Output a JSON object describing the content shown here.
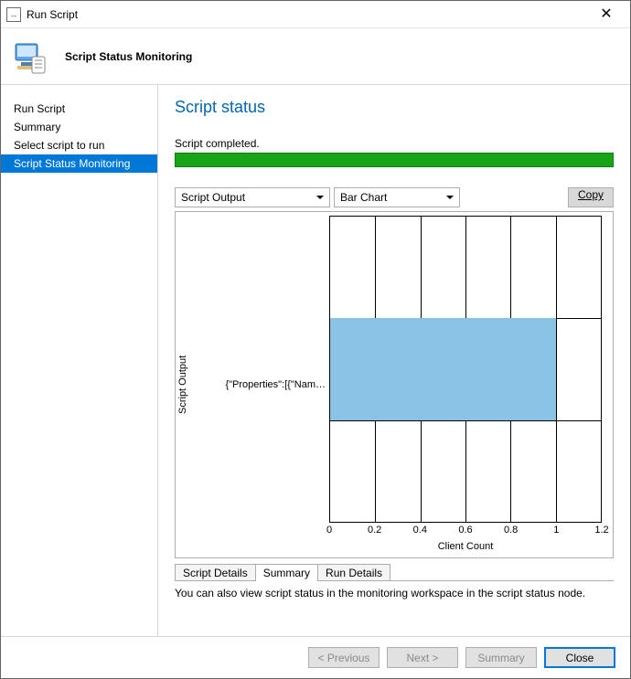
{
  "window": {
    "title": "Run Script"
  },
  "header": {
    "title": "Script Status Monitoring"
  },
  "sidebar": {
    "items": [
      {
        "label": "Run Script",
        "selected": false
      },
      {
        "label": "Summary",
        "selected": false
      },
      {
        "label": "Select script to run",
        "selected": false
      },
      {
        "label": "Script Status Monitoring",
        "selected": true
      }
    ]
  },
  "main": {
    "page_title": "Script status",
    "status_text": "Script completed.",
    "progress_color": "#17a417",
    "combo_output": "Script Output",
    "combo_charttype": "Bar Chart",
    "copy_label": "Copy",
    "hint": "You can also view script status in the monitoring workspace in the script status node.",
    "tabs": [
      {
        "label": "Script Details",
        "active": false
      },
      {
        "label": "Summary",
        "active": true
      },
      {
        "label": "Run Details",
        "active": false
      }
    ]
  },
  "chart_data": {
    "type": "bar",
    "orientation": "horizontal",
    "categories": [
      "{\"Properties\":[{\"Nam…"
    ],
    "values": [
      1
    ],
    "ylabel": "Script Output",
    "xlabel": "Client Count",
    "xlim": [
      0,
      1.2
    ],
    "x_ticks": [
      0,
      0.2,
      0.4,
      0.6,
      0.8,
      1,
      1.2
    ],
    "bar_color": "#8ac3e6"
  },
  "footer": {
    "previous": "< Previous",
    "next": "Next >",
    "summary": "Summary",
    "close": "Close"
  }
}
